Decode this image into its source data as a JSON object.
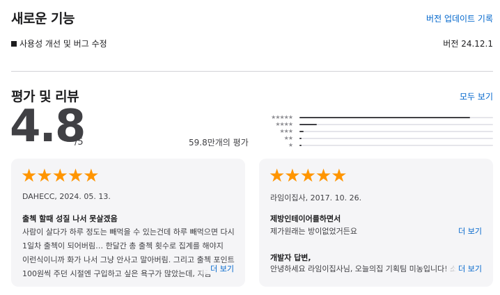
{
  "whats_new": {
    "title": "새로운 기능",
    "version_history_link": "버전 업데이트 기록",
    "change_item": "사용성 개선 및 버그 수정",
    "version": "버전 24.12.1"
  },
  "ratings": {
    "title": "평가 및 리뷰",
    "see_all": "모두 보기",
    "score": "4.8",
    "score_max": "/5",
    "rating_count": "59.8만개의 평가",
    "histogram": [
      {
        "stars": 5,
        "label": "★★★★★",
        "fraction": 0.88
      },
      {
        "stars": 4,
        "label": "★★★★",
        "fraction": 0.09
      },
      {
        "stars": 3,
        "label": "★★★",
        "fraction": 0.02
      },
      {
        "stars": 2,
        "label": "★★",
        "fraction": 0.005
      },
      {
        "stars": 1,
        "label": "★",
        "fraction": 0.01
      }
    ]
  },
  "reviews": [
    {
      "stars": "★★★★★",
      "author_date": "DAHECC, 2024. 05. 13.",
      "title": "출첵 할때 성질 나서 못살겠음",
      "body_lines": [
        "사람이 살다가 하루 정도는 빼먹을 수 있는건데 하루 빼먹으면 다시",
        "1일차 출첵이 되어버림… 한달간 총 출첵 횟수로 집계를 해야지",
        "이런식이니까 화가 나서 그냥 안사고 말아버림. 그리고 출첵 포인트",
        "100원씩 주던 시절엔 구입하고 싶은 욕구가 많았는데, 지금"
      ],
      "more": "더 보기"
    },
    {
      "stars": "★★★★★",
      "author_date": "라임이집사, 2017. 10. 26.",
      "title": "제방인테이어를하면서",
      "body": "제가원래는 방이없었거든요",
      "more": "더 보기",
      "developer_title": "개발자 답변,",
      "developer_body": "안녕하세요 라임이집사님, 오늘의집 기획팀 미농입니다! 소중한",
      "developer_more": "더 보기"
    }
  ],
  "colors": {
    "link": "#0066cc",
    "star": "#ff9500",
    "card_bg": "#f5f5f7",
    "bar": "#404044"
  }
}
